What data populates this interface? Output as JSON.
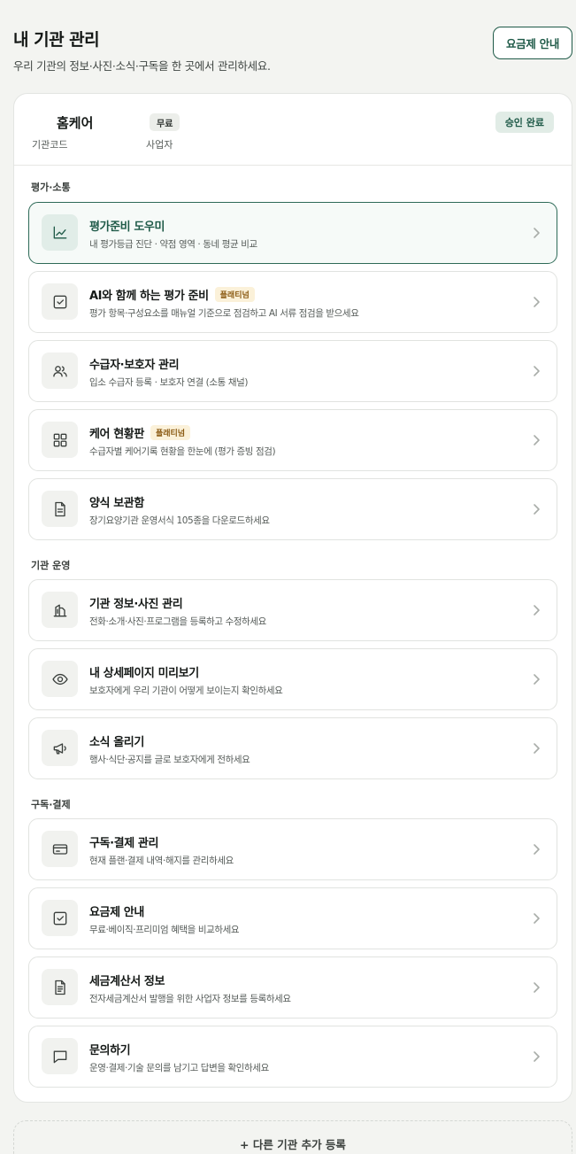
{
  "header": {
    "title": "내 기관 관리",
    "subtitle": "우리 기관의 정보·사진·소식·구독을 한 곳에서 관리하세요.",
    "plan_button": "요금제 안내"
  },
  "org": {
    "name": "홈케어",
    "code_label": "기관코드",
    "plan_badge": "무료",
    "biz_label": "사업자",
    "status": "승인 완료"
  },
  "sections": [
    {
      "title": "평가·소통",
      "items": [
        {
          "title": "평가준비 도우미",
          "desc": "내 평가등급 진단 · 약점 영역 · 동네 평균 비교",
          "icon": "chart-line-icon",
          "active": true
        },
        {
          "title": "AI와 함께 하는 평가 준비",
          "tag": "플래티넘",
          "desc": "평가 항목·구성요소를 매뉴얼 기준으로 점검하고 AI 서류 점검을 받으세요",
          "icon": "check-square-icon"
        },
        {
          "title": "수급자·보호자 관리",
          "desc": "입소 수급자 등록 · 보호자 연결 (소통 채널)",
          "icon": "users-icon"
        },
        {
          "title": "케어 현황판",
          "tag": "플래티넘",
          "desc": "수급자별 케어기록 현황을 한눈에 (평가 증빙 점검)",
          "icon": "dashboard-grid-icon"
        },
        {
          "title": "양식 보관함",
          "desc": "장기요양기관 운영서식 105종을 다운로드하세요",
          "icon": "document-icon"
        }
      ]
    },
    {
      "title": "기관 운영",
      "items": [
        {
          "title": "기관 정보·사진 관리",
          "desc": "전화·소개·사진·프로그램을 등록하고 수정하세요",
          "icon": "building-icon"
        },
        {
          "title": "내 상세페이지 미리보기",
          "desc": "보호자에게 우리 기관이 어떻게 보이는지 확인하세요",
          "icon": "eye-icon"
        },
        {
          "title": "소식 올리기",
          "desc": "행사·식단·공지를 글로 보호자에게 전하세요",
          "icon": "megaphone-icon"
        }
      ]
    },
    {
      "title": "구독·결제",
      "items": [
        {
          "title": "구독·결제 관리",
          "desc": "현재 플랜·결제 내역·해지를 관리하세요",
          "icon": "credit-card-icon"
        },
        {
          "title": "요금제 안내",
          "desc": "무료·베이직·프리미엄 혜택을 비교하세요",
          "icon": "check-square-icon"
        },
        {
          "title": "세금계산서 정보",
          "desc": "전자세금계산서 발행을 위한 사업자 정보를 등록하세요",
          "icon": "invoice-icon"
        },
        {
          "title": "문의하기",
          "desc": "운영·결제·기술 문의를 남기고 답변을 확인하세요",
          "icon": "chat-bubble-icon"
        }
      ]
    }
  ],
  "footer": {
    "add_org_button": "+ 다른 기관 추가 등록"
  }
}
